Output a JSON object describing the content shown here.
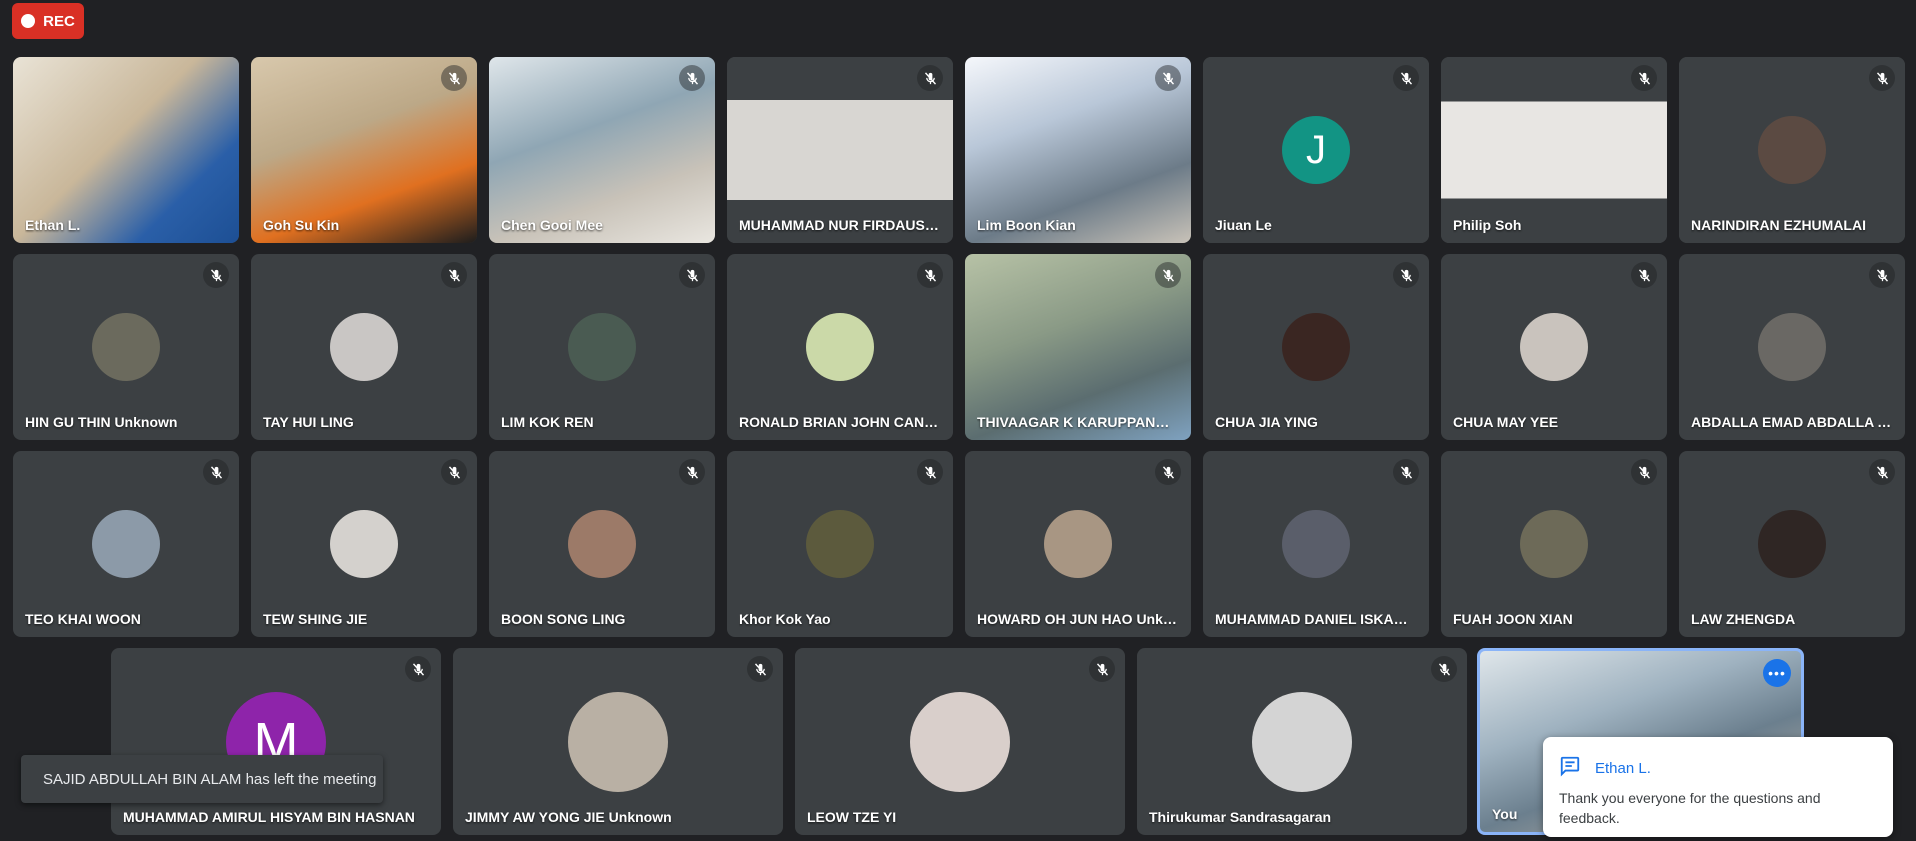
{
  "recording": {
    "label": "REC"
  },
  "grid": {
    "row1": [
      {
        "name": "Ethan L.",
        "muted": false,
        "bg": "linear-gradient(135deg,#e9e3d6 0%,#c9b79a 45%,#2a5fa8 75%,#1d4f94 100%)",
        "avatar": null
      },
      {
        "name": "Goh Su Kin",
        "muted": true,
        "bg": "linear-gradient(160deg,#d8c8ac 0%,#bca887 40%,#e07020 70%,#1d1d1d 100%)",
        "avatar": null
      },
      {
        "name": "Chen Gooi Mee",
        "muted": true,
        "bg": "linear-gradient(160deg,#dfe6ea 0%,#8fa6b4 40%,#c8c2b8 70%,#e9e6e0 100%)",
        "avatar": null
      },
      {
        "name": "MUHAMMAD NUR FIRDAUS BIN NAZIM...",
        "muted": true,
        "bg": "linear-gradient(180deg,#3c4043 0 23%,#d8d6d2 23% 77%,#3c4043 77%)",
        "avatar": null
      },
      {
        "name": "Lim Boon Kian",
        "muted": true,
        "bg": "linear-gradient(160deg,#f5f7fb 0%,#b9c7d8 35%,#6c7b88 70%,#c8c2b8 100%)",
        "avatar": null
      },
      {
        "name": "Jiuan Le",
        "muted": true,
        "bg": "#3c4043",
        "avatar": {
          "letter": "J",
          "color": "#129484"
        }
      },
      {
        "name": "Philip Soh",
        "muted": true,
        "bg": "linear-gradient(180deg,#3c4043 0 24%,#e8e6e3 24% 76%,#3c4043 76%)",
        "avatar": null
      },
      {
        "name": "NARINDIRAN EZHUMALAI",
        "muted": true,
        "bg": "#3c4043",
        "avatar": {
          "letter": "",
          "color": "#5b4a42"
        }
      }
    ],
    "row2": [
      {
        "name": "HIN GU THIN Unknown",
        "muted": true,
        "avatar": {
          "letter": "",
          "color": "#6b6a5d"
        }
      },
      {
        "name": "TAY HUI LING",
        "muted": true,
        "avatar": {
          "letter": "",
          "color": "#c9c6c4"
        }
      },
      {
        "name": "LIM KOK REN",
        "muted": true,
        "avatar": {
          "letter": "",
          "color": "#4a5b52"
        }
      },
      {
        "name": "RONALD BRIAN JOHN CANTUM...",
        "muted": true,
        "avatar": {
          "letter": "",
          "color": "#cbd9a8"
        }
      },
      {
        "name": "THIVAAGAR K KARUPPANNAN...",
        "muted": true,
        "bg": "linear-gradient(160deg,#b7c2a6 0%,#8a9a86 40%,#5b6d70 70%,#7fa2c0 100%)",
        "avatar": null
      },
      {
        "name": "CHUA JIA YING",
        "muted": true,
        "avatar": {
          "letter": "",
          "color": "#3a2622"
        }
      },
      {
        "name": "CHUA MAY YEE",
        "muted": true,
        "avatar": {
          "letter": "",
          "color": "#c9c3bd"
        }
      },
      {
        "name": "ABDALLA EMAD ABDALLA ABDAL...",
        "muted": true,
        "avatar": {
          "letter": "",
          "color": "#6a6864"
        }
      }
    ],
    "row3": [
      {
        "name": "TEO KHAI WOON",
        "muted": true,
        "avatar": {
          "letter": "",
          "color": "#8c9aa8"
        }
      },
      {
        "name": "TEW SHING JIE",
        "muted": true,
        "avatar": {
          "letter": "",
          "color": "#d4d1cd"
        }
      },
      {
        "name": "BOON SONG LING",
        "muted": true,
        "avatar": {
          "letter": "",
          "color": "#9c7a68"
        }
      },
      {
        "name": "Khor Kok Yao",
        "muted": true,
        "avatar": {
          "letter": "",
          "color": "#5c5a3d"
        }
      },
      {
        "name": "HOWARD OH JUN HAO Unknown",
        "muted": true,
        "avatar": {
          "letter": "",
          "color": "#a89683"
        }
      },
      {
        "name": "MUHAMMAD DANIEL ISKANDAR...",
        "muted": true,
        "avatar": {
          "letter": "",
          "color": "#5a5e6a"
        }
      },
      {
        "name": "FUAH JOON XIAN",
        "muted": true,
        "avatar": {
          "letter": "",
          "color": "#6d6a58"
        }
      },
      {
        "name": "LAW ZHENGDA",
        "muted": true,
        "avatar": {
          "letter": "",
          "color": "#2f2624"
        }
      }
    ],
    "row4": [
      {
        "name": "MUHAMMAD AMIRUL HISYAM BIN HASNAN",
        "muted": true,
        "avatar": {
          "letter": "M",
          "color": "#8e24aa"
        }
      },
      {
        "name": "JIMMY AW YONG JIE Unknown",
        "muted": true,
        "avatar": {
          "letter": "",
          "color": "#b9b0a4"
        }
      },
      {
        "name": "LEOW TZE YI",
        "muted": true,
        "avatar": {
          "letter": "",
          "color": "#d9cfcb"
        }
      },
      {
        "name": "Thirukumar Sandrasagaran",
        "muted": true,
        "avatar": {
          "letter": "",
          "color": "#d4d4d4"
        }
      }
    ],
    "self": {
      "name": "You",
      "more_icon": "more-horizontal-icon"
    }
  },
  "toast": {
    "text": "SAJID ABDULLAH BIN ALAM has left the meeting"
  },
  "chat_popup": {
    "sender": "Ethan L.",
    "message": "Thank you everyone for the questions and feedback.",
    "icon": "chat-bubble-icon"
  }
}
